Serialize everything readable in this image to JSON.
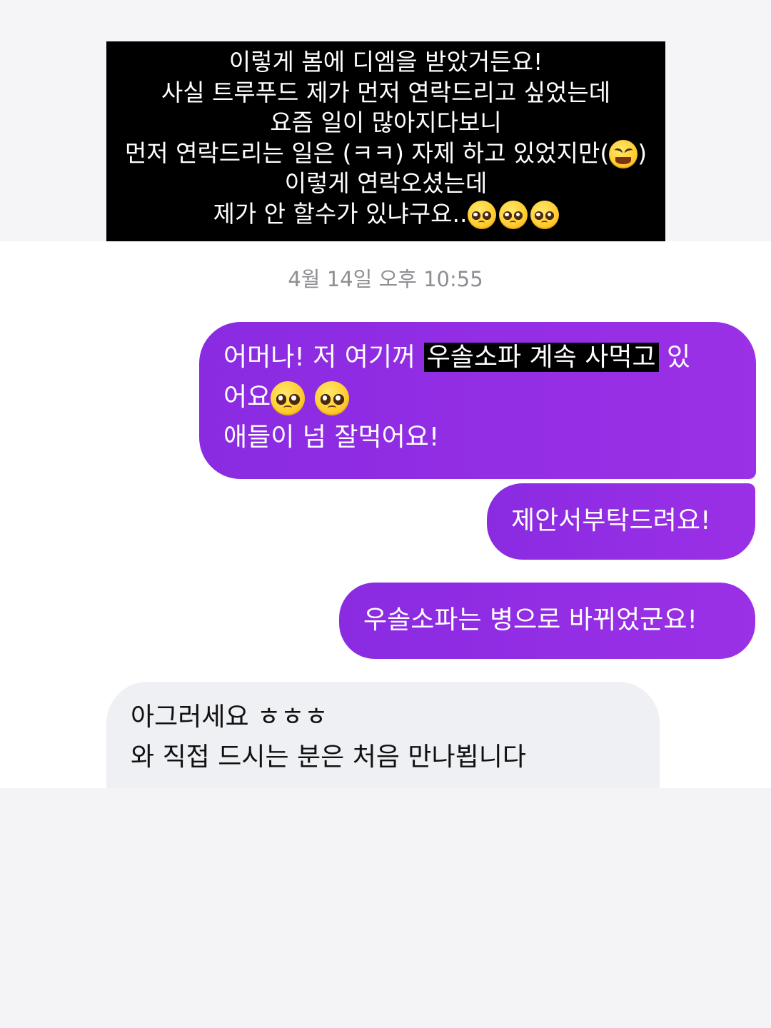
{
  "caption": {
    "lines": [
      "이렇게 봄에 디엠을 받았거든요!",
      "사실 트루푸드 제가 먼저 연락드리고 싶었는데",
      "요즘 일이 많아지다보니",
      "먼저 연락드리는 일은 (ㅋㅋ) 자제 하고 있었지만(",
      ")",
      "이렇게 연락오셨는데",
      "제가 안 할수가 있냐구요.."
    ]
  },
  "chat": {
    "timestamp": "4월 14일 오후 10:55",
    "messages": [
      {
        "side": "sent",
        "line1_before": "어머나! 저 여기꺼 ",
        "line1_highlight": "우솔소파 계속 사먹고",
        "line1_after": " 있",
        "line2": "어요",
        "line3": "애들이 넘 잘먹어요!"
      },
      {
        "side": "sent",
        "text": "제안서부탁드려요!"
      },
      {
        "side": "sent",
        "text": "우솔소파는 병으로 바뀌었군요!"
      },
      {
        "side": "received",
        "line1": "아그러세요 ㅎㅎㅎ",
        "line2": "와 직접 드시는 분은 처음 만나뵙니다"
      }
    ]
  },
  "emoji_icons": [
    "grinning-squinting-face-icon",
    "pleading-face-icon"
  ],
  "colors": {
    "sent_bubble": "#8a2be2",
    "received_bubble": "#eff0f4",
    "caption_background": "#000000",
    "timestamp_text": "#8e8e93"
  }
}
